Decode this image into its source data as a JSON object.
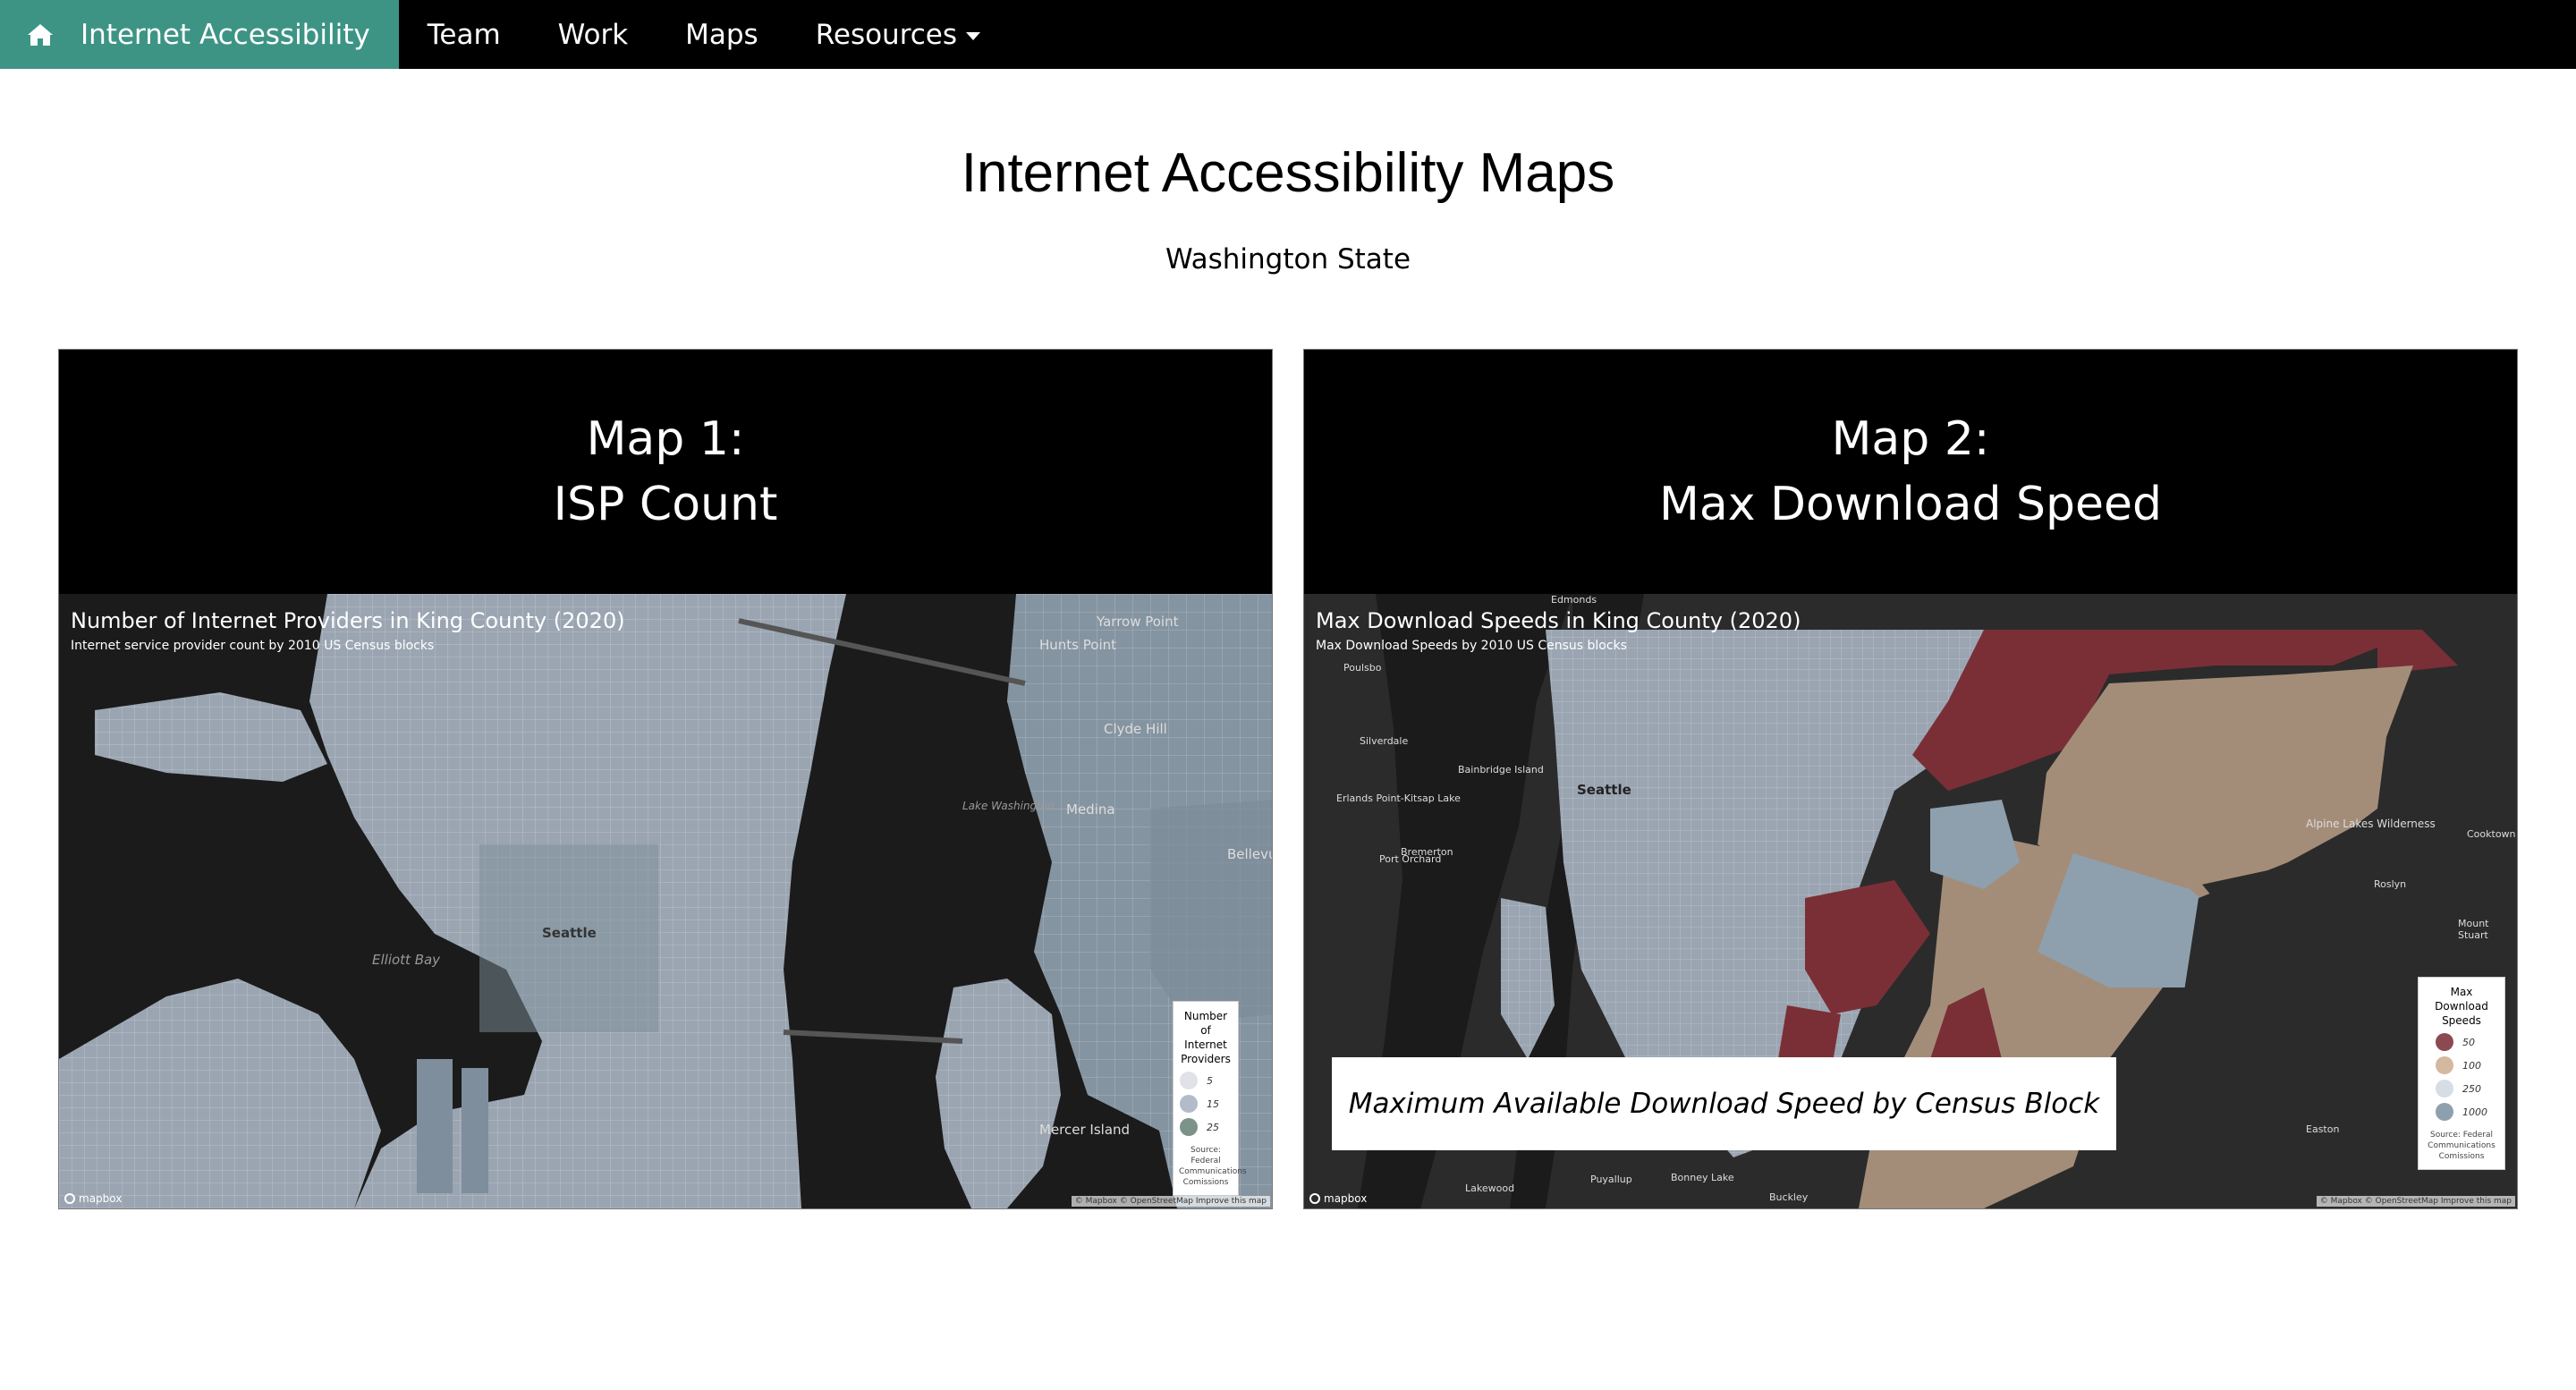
{
  "navbar": {
    "brand": "Internet Accessibility",
    "items": [
      "Team",
      "Work",
      "Maps",
      "Resources"
    ]
  },
  "page": {
    "title": "Internet Accessibility Maps",
    "subtitle": "Washington State"
  },
  "map1": {
    "header_line1": "Map 1:",
    "header_line2": "ISP Count",
    "title": "Number of Internet Providers in King County (2020)",
    "subtitle": "Internet service provider count by 2010 US Census blocks",
    "legend": {
      "title_lines": [
        "Number of",
        "Internet",
        "Providers"
      ],
      "items": [
        {
          "value": "5",
          "color": "#e1e2e8"
        },
        {
          "value": "15",
          "color": "#b2bcc8"
        },
        {
          "value": "25",
          "color": "#7d9288"
        }
      ],
      "source": [
        "Source: Federal",
        "Communications",
        "Comissions"
      ]
    },
    "places": [
      "Seattle",
      "Elliott Bay",
      "Bellevue",
      "Medina",
      "Lake Washington",
      "Mercer Island",
      "Clyde Hill",
      "Yarrow Point",
      "Hunts Point"
    ],
    "logo": "mapbox",
    "attribution": "© Mapbox © OpenStreetMap Improve this map"
  },
  "map2": {
    "header_line1": "Map 2:",
    "header_line2": "Max Download Speed",
    "title": "Max Download Speeds in King County (2020)",
    "subtitle": "Max Download Speeds by 2010 US Census blocks",
    "caption": "Maximum Available Download Speed by Census Block",
    "legend": {
      "title_lines": [
        "Max",
        "Download",
        "Speeds"
      ],
      "items": [
        {
          "value": "50",
          "color": "#8b4a52"
        },
        {
          "value": "100",
          "color": "#d4b8a0"
        },
        {
          "value": "250",
          "color": "#d6dde5"
        },
        {
          "value": "1000",
          "color": "#8ea0ad"
        }
      ],
      "source": [
        "Source: Federal",
        "Communications",
        "Comissions"
      ]
    },
    "places": [
      "Seattle",
      "Edmonds",
      "Poulsbo",
      "Silverdale",
      "Bainbridge Island",
      "Bremerton",
      "Port Orchard",
      "Erlands Point-Kitsap Lake",
      "Alpine Lakes Wilderness",
      "Lakewood",
      "Puyallup",
      "Bonney Lake",
      "Buckley",
      "Easton",
      "Mount Stuart",
      "Cooktown",
      "Roslyn"
    ],
    "logo": "mapbox",
    "attribution": "© Mapbox © OpenStreetMap Improve this map"
  },
  "colors": {
    "brand_bg": "#3d9485",
    "navbar_bg": "#000000",
    "water": "#1b1b1b",
    "land_light": "#9aa5b1",
    "land_dark": "#2b2b2b",
    "speed_low": "#7a2f36",
    "speed_mid": "#a38d79"
  }
}
